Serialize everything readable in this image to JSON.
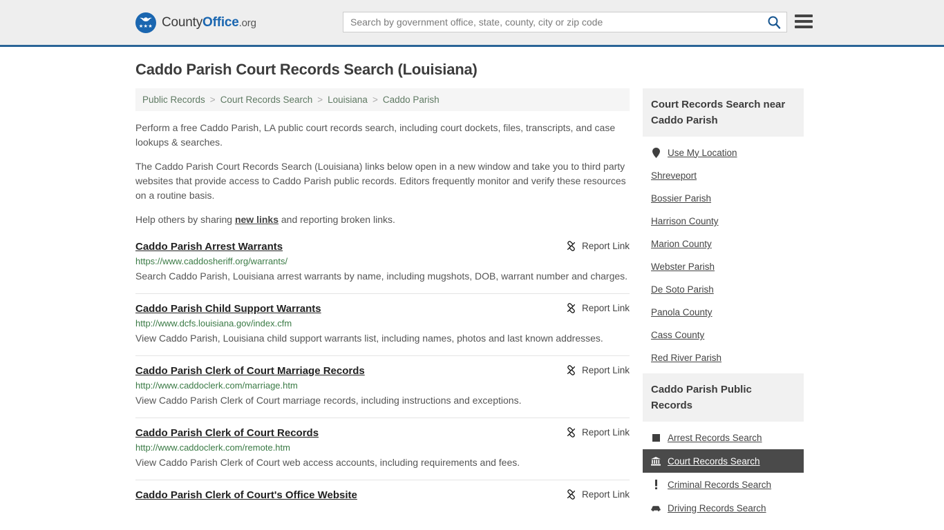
{
  "header": {
    "brand": {
      "part1": "County",
      "part2": "Office",
      "part3": ".org",
      "logo_icon": "eagle-seal-logo",
      "stars": "★★★"
    },
    "search": {
      "placeholder": "Search by government office, state, county, city or zip code",
      "value": "",
      "search_icon": "search-icon",
      "menu_icon": "hamburger-menu-icon"
    }
  },
  "page": {
    "title": "Caddo Parish Court Records Search (Louisiana)"
  },
  "breadcrumb": {
    "items": [
      {
        "label": "Public Records"
      },
      {
        "label": "Court Records Search"
      },
      {
        "label": "Louisiana"
      },
      {
        "label": "Caddo Parish"
      }
    ],
    "separator": ">"
  },
  "intro": {
    "p1": "Perform a free Caddo Parish, LA public court records search, including court dockets, files, transcripts, and case lookups & searches.",
    "p2": "The Caddo Parish Court Records Search (Louisiana) links below open in a new window and take you to third party websites that provide access to Caddo Parish public records. Editors frequently monitor and verify these resources on a routine basis.",
    "p3_before": "Help others by sharing ",
    "p3_link": "new links",
    "p3_after": " and reporting broken links."
  },
  "results": {
    "report_label": "Report Link",
    "report_icon": "broken-link-icon",
    "items": [
      {
        "title": "Caddo Parish Arrest Warrants",
        "url": "https://www.caddosheriff.org/warrants/",
        "desc": "Search Caddo Parish, Louisiana arrest warrants by name, including mugshots, DOB, warrant number and charges."
      },
      {
        "title": "Caddo Parish Child Support Warrants",
        "url": "http://www.dcfs.louisiana.gov/index.cfm",
        "desc": "View Caddo Parish, Louisiana child support warrants list, including names, photos and last known addresses."
      },
      {
        "title": "Caddo Parish Clerk of Court Marriage Records",
        "url": "http://www.caddoclerk.com/marriage.htm",
        "desc": "View Caddo Parish Clerk of Court marriage records, including instructions and exceptions."
      },
      {
        "title": "Caddo Parish Clerk of Court Records",
        "url": "http://www.caddoclerk.com/remote.htm",
        "desc": "View Caddo Parish Clerk of Court web access accounts, including requirements and fees."
      },
      {
        "title": "Caddo Parish Clerk of Court's Office Website",
        "url": "",
        "desc": ""
      }
    ]
  },
  "sidebar": {
    "nearby": {
      "heading": "Court Records Search near Caddo Parish",
      "items": [
        {
          "label": "Use My Location",
          "icon": "map-pin-icon",
          "active": false
        },
        {
          "label": "Shreveport",
          "icon": "",
          "active": false
        },
        {
          "label": "Bossier Parish",
          "icon": "",
          "active": false
        },
        {
          "label": "Harrison County",
          "icon": "",
          "active": false
        },
        {
          "label": "Marion County",
          "icon": "",
          "active": false
        },
        {
          "label": "Webster Parish",
          "icon": "",
          "active": false
        },
        {
          "label": "De Soto Parish",
          "icon": "",
          "active": false
        },
        {
          "label": "Panola County",
          "icon": "",
          "active": false
        },
        {
          "label": "Cass County",
          "icon": "",
          "active": false
        },
        {
          "label": "Red River Parish",
          "icon": "",
          "active": false
        }
      ]
    },
    "public_records": {
      "heading": "Caddo Parish Public Records",
      "items": [
        {
          "label": "Arrest Records Search",
          "icon": "square-icon",
          "active": false
        },
        {
          "label": "Court Records Search",
          "icon": "courthouse-icon",
          "active": true
        },
        {
          "label": "Criminal Records Search",
          "icon": "exclamation-icon",
          "active": false
        },
        {
          "label": "Driving Records Search",
          "icon": "car-icon",
          "active": false
        }
      ]
    }
  },
  "colors": {
    "brand_blue": "#1a66b0",
    "header_bg": "#eeeeee",
    "header_border": "#2a6496",
    "url_green": "#3a7a45",
    "breadcrumb_text": "#5f7a63",
    "active_bg": "#4a4a4a"
  }
}
